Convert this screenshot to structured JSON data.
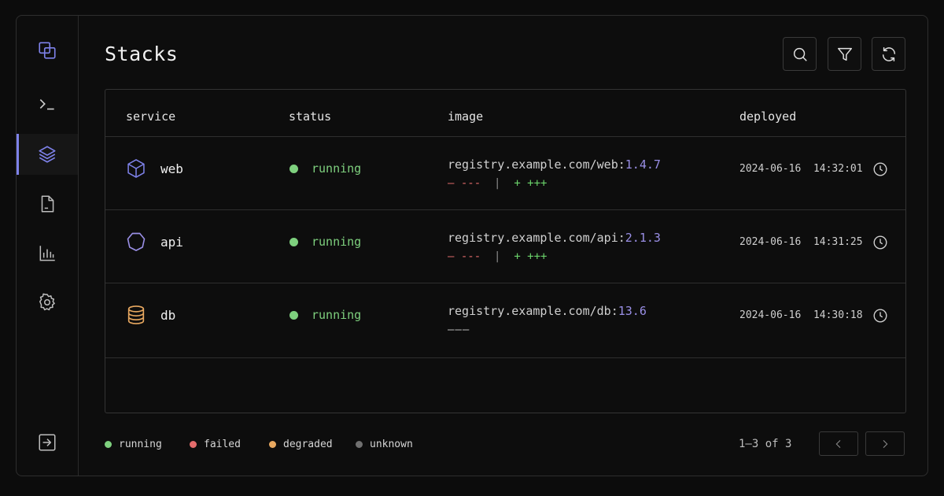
{
  "page": {
    "title": "Stacks"
  },
  "colors": {
    "accent": "#7e82ea",
    "running": "#7ed07e",
    "failed": "#e46c6c",
    "degraded": "#e8a860",
    "unknown": "#707070"
  },
  "sidebar": {
    "items": [
      {
        "icon": "copy-squares-icon",
        "active": false
      },
      {
        "icon": "terminal-icon",
        "active": false
      },
      {
        "icon": "layers-icon",
        "active": true
      },
      {
        "icon": "file-icon",
        "active": false
      },
      {
        "icon": "bar-chart-icon",
        "active": false
      },
      {
        "icon": "gear-icon",
        "active": false
      }
    ],
    "footer_icon": "logout-icon"
  },
  "toolbar": {
    "icons": [
      "search-icon",
      "filter-icon",
      "refresh-icon"
    ]
  },
  "table": {
    "headers": {
      "service": "service",
      "status": "status",
      "image": "image",
      "deployed": "deployed"
    },
    "rows": [
      {
        "service": "web",
        "icon": "cube-icon",
        "status": "running",
        "image_repo": "registry.example.com/web:",
        "image_tag": "1.4.7",
        "diff_del": "— ---",
        "diff_sep": "|",
        "diff_add": "+ +++",
        "deployed_date": "2024-06-16",
        "deployed_time": "14:32:01"
      },
      {
        "service": "api",
        "icon": "hexagon-icon",
        "status": "running",
        "image_repo": "registry.example.com/api:",
        "image_tag": "2.1.3",
        "diff_del": "— ---",
        "diff_sep": "|",
        "diff_add": "+ +++",
        "deployed_date": "2024-06-16",
        "deployed_time": "14:31:25"
      },
      {
        "service": "db",
        "icon": "database-icon",
        "status": "running",
        "image_repo": "registry.example.com/db:",
        "image_tag": "13.6",
        "diff_none": "———",
        "deployed_date": "2024-06-16",
        "deployed_time": "14:30:18"
      }
    ]
  },
  "legend": [
    {
      "label": "running"
    },
    {
      "label": "failed"
    },
    {
      "label": "degraded"
    },
    {
      "label": "unknown"
    }
  ],
  "pagination": {
    "info": "1–3 of 3"
  }
}
